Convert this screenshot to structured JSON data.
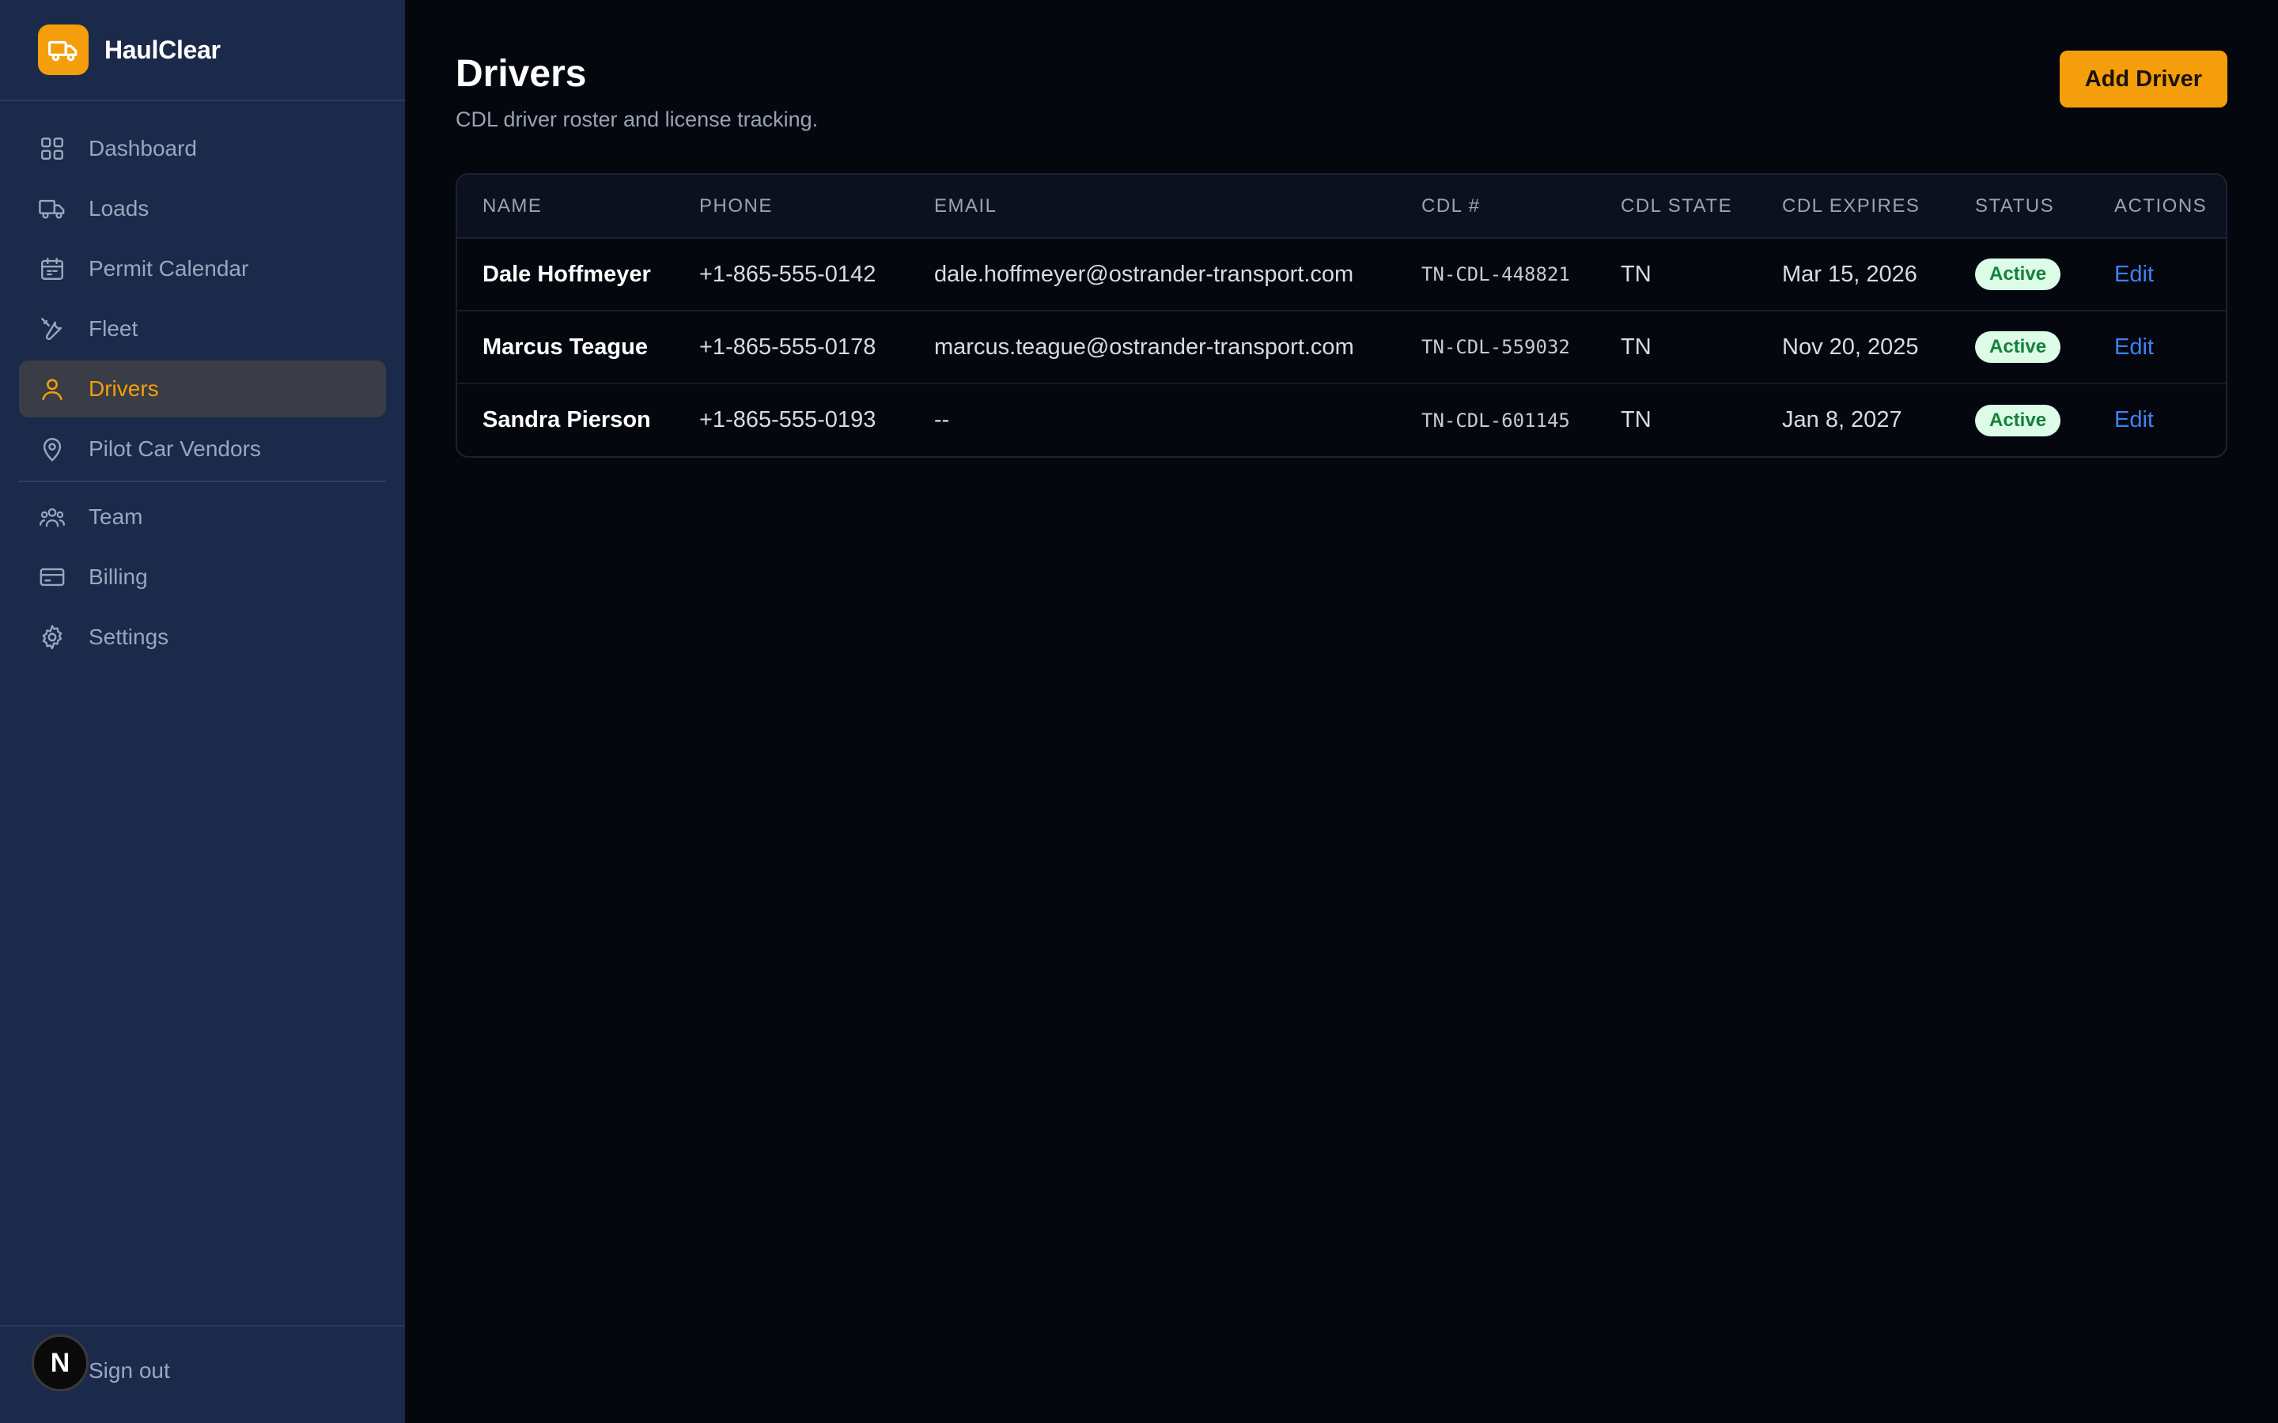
{
  "app": {
    "name": "HaulClear"
  },
  "sidebar": {
    "items": [
      {
        "label": "Dashboard",
        "icon": "dashboard-grid-icon",
        "active": false
      },
      {
        "label": "Loads",
        "icon": "truck-icon",
        "active": false
      },
      {
        "label": "Permit Calendar",
        "icon": "calendar-icon",
        "active": false
      },
      {
        "label": "Fleet",
        "icon": "tools-icon",
        "active": false
      },
      {
        "label": "Drivers",
        "icon": "user-icon",
        "active": true
      },
      {
        "label": "Pilot Car Vendors",
        "icon": "map-pin-icon",
        "active": false
      }
    ],
    "secondary_items": [
      {
        "label": "Team",
        "icon": "users-icon"
      },
      {
        "label": "Billing",
        "icon": "credit-card-icon"
      },
      {
        "label": "Settings",
        "icon": "gear-icon"
      }
    ],
    "footer": {
      "avatar_initial": "N",
      "signout_label": "Sign out"
    }
  },
  "page": {
    "title": "Drivers",
    "subtitle": "CDL driver roster and license tracking.",
    "add_button": "Add Driver"
  },
  "table": {
    "columns": [
      "NAME",
      "PHONE",
      "EMAIL",
      "CDL #",
      "CDL STATE",
      "CDL EXPIRES",
      "STATUS",
      "ACTIONS"
    ],
    "rows": [
      {
        "name": "Dale Hoffmeyer",
        "phone": "+1-865-555-0142",
        "email": "dale.hoffmeyer@ostrander-transport.com",
        "cdl": "TN-CDL-448821",
        "state": "TN",
        "expires": "Mar 15, 2026",
        "status": "Active",
        "action": "Edit"
      },
      {
        "name": "Marcus Teague",
        "phone": "+1-865-555-0178",
        "email": "marcus.teague@ostrander-transport.com",
        "cdl": "TN-CDL-559032",
        "state": "TN",
        "expires": "Nov 20, 2025",
        "status": "Active",
        "action": "Edit"
      },
      {
        "name": "Sandra Pierson",
        "phone": "+1-865-555-0193",
        "email": "--",
        "cdl": "TN-CDL-601145",
        "state": "TN",
        "expires": "Jan 8, 2027",
        "status": "Active",
        "action": "Edit"
      }
    ]
  },
  "colors": {
    "accent": "#f59e0b",
    "sidebar_bg": "#1b2a4a",
    "main_bg": "#05070f",
    "link": "#3b82f6",
    "status_active_bg": "#dcfce7",
    "status_active_text": "#15803d"
  }
}
